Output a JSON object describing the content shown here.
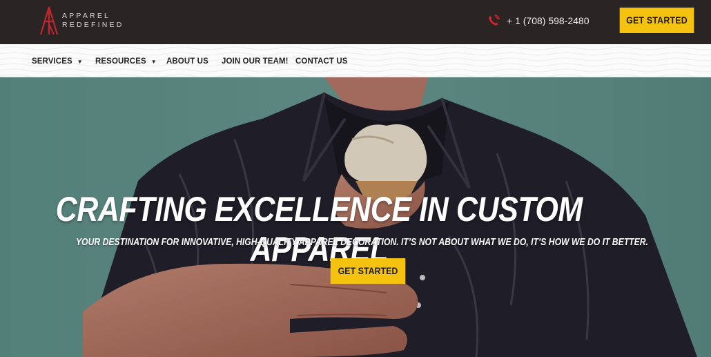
{
  "brand": {
    "line1": "APPAREL",
    "line2": "REDEFINED",
    "accent_color": "#c0262d"
  },
  "header": {
    "phone_icon": "phone-ringing-icon",
    "phone_text": "+ 1 (708) 598-2480",
    "cta_label": "GET STARTED",
    "cta_color": "#f4c20f"
  },
  "nav": {
    "items": [
      {
        "label": "SERVICES",
        "has_dropdown": true
      },
      {
        "label": "RESOURCES",
        "has_dropdown": true
      },
      {
        "label": "ABOUT US",
        "has_dropdown": false
      },
      {
        "label": "JOIN OUR TEAM!",
        "has_dropdown": false
      },
      {
        "label": "CONTACT US",
        "has_dropdown": false
      }
    ],
    "caret": "▼"
  },
  "hero": {
    "title": "CRAFTING EXCELLENCE IN CUSTOM APPAREL",
    "subtitle": "YOUR DESTINATION FOR INNOVATIVE, HIGH-QUALITY APPAREL DECORATION. IT’S NOT ABOUT WHAT WE DO, IT’S HOW WE DO IT BETTER.",
    "cta_label": "GET STARTED",
    "background_image": "person-in-dark-shirt-holding-ice-cream-cone"
  }
}
